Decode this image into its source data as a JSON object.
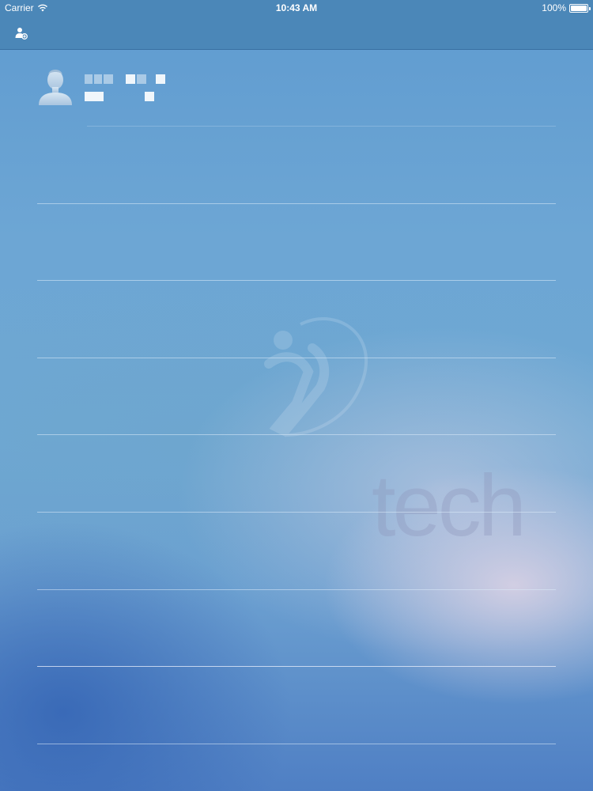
{
  "status_bar": {
    "carrier": "Carrier",
    "time": "10:43 AM",
    "battery": "100%"
  },
  "nav_bar": {
    "add_contact_icon": "add-contact-icon"
  },
  "watermark": {
    "text": "tech",
    "logo_icon": "figure-logo-icon"
  },
  "profile": {
    "avatar_icon": "person-silhouette-icon",
    "name": "",
    "subtitle": ""
  },
  "list": {
    "row_count": 8
  }
}
